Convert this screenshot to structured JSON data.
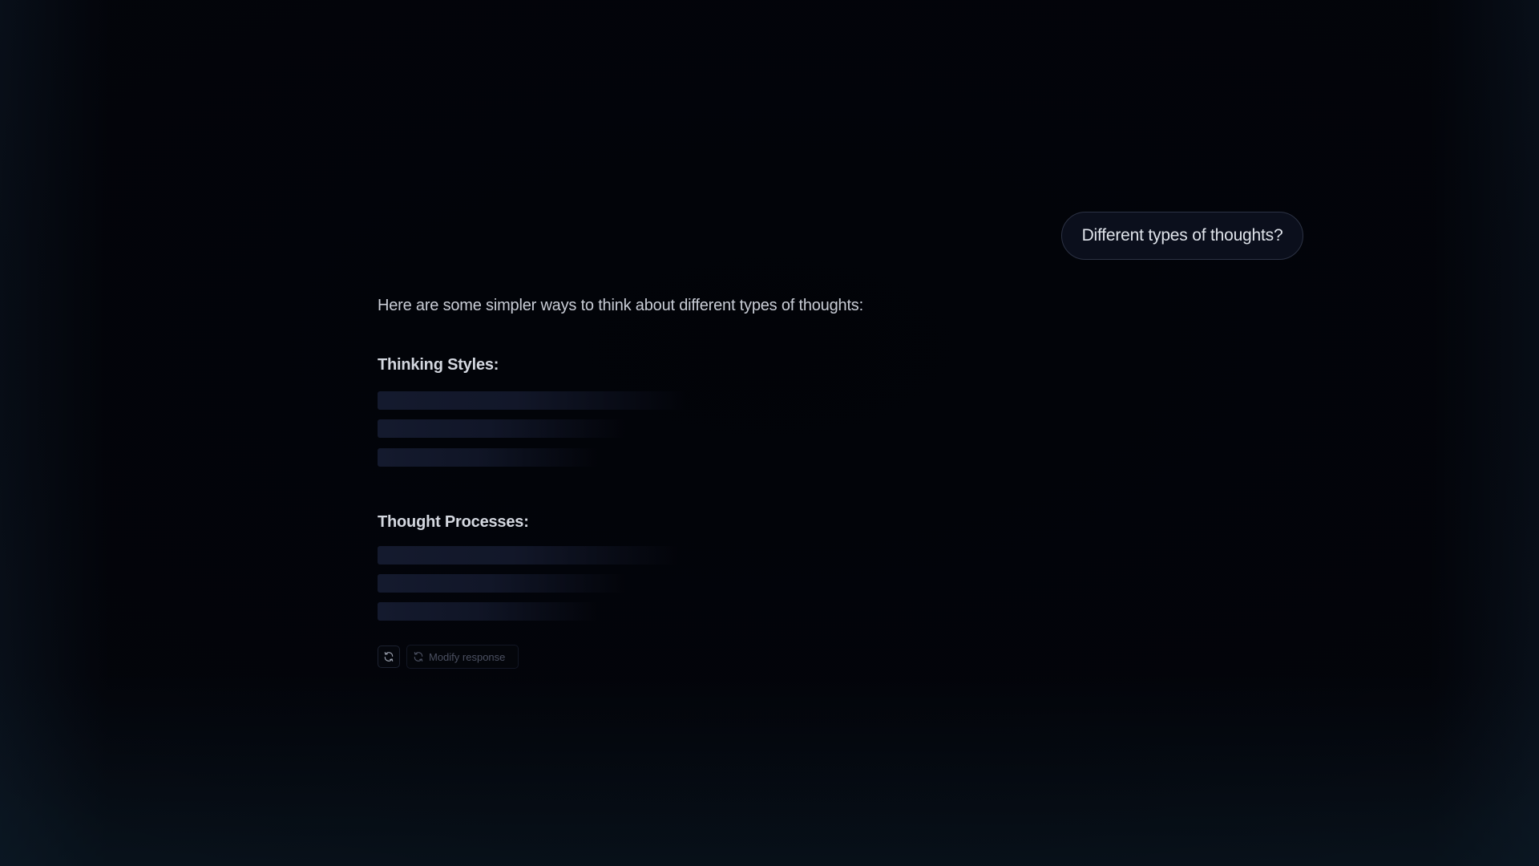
{
  "user_message": {
    "text": "Different types of thoughts?"
  },
  "assistant_message": {
    "intro": "Here are some simpler ways to think about different types of thoughts:",
    "sections": [
      {
        "heading": "Thinking Styles:",
        "placeholder_lines": 3
      },
      {
        "heading": "Thought Processes:",
        "placeholder_lines": 3
      }
    ]
  },
  "actions": {
    "regenerate_icon": "refresh-icon",
    "modify_label": "Modify response",
    "modify_icon": "refresh-icon"
  },
  "colors": {
    "background": "#03050b",
    "bubble_background": "#0b0f1c",
    "bubble_border": "#2c3244",
    "skeleton": "#141a2e",
    "text_primary": "#d7dbe3",
    "text_muted": "#4b5061"
  }
}
